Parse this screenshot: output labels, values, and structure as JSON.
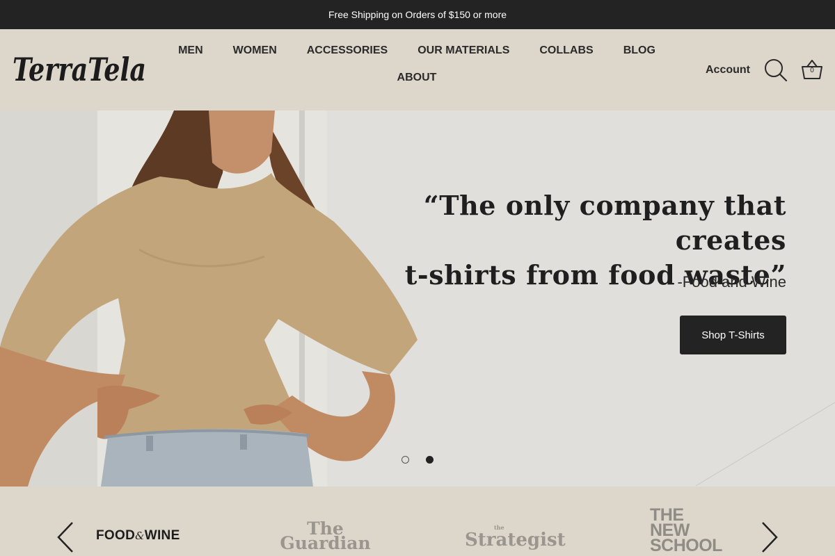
{
  "announcement": "Free Shipping on Orders of $150 or more",
  "brand": {
    "name": "TerraTela"
  },
  "nav": {
    "items": [
      "MEN",
      "WOMEN",
      "ACCESSORIES",
      "OUR MATERIALS",
      "COLLABS",
      "BLOG",
      "ABOUT"
    ]
  },
  "header_actions": {
    "account_label": "Account",
    "search_icon": "search-icon",
    "cart_icon": "basket-icon",
    "cart_count": "0"
  },
  "hero": {
    "quote_line1": "“The only company that creates",
    "quote_line2": "t-shirts from food waste”",
    "attribution": "-Food and Wine",
    "cta_label": "Shop T-Shirts",
    "slides_total": 2,
    "active_slide": 2
  },
  "press": {
    "logos": [
      {
        "name": "FOOD & WINE",
        "parts": [
          "FOOD",
          "&",
          "WINE"
        ]
      },
      {
        "name": "The Guardian",
        "parts": [
          "The",
          "Guardian"
        ]
      },
      {
        "name": "The Strategist",
        "parts": [
          "the",
          "Strategist"
        ]
      },
      {
        "name": "THE NEW SCHOOL",
        "parts": [
          "THE",
          "NEW",
          "SCHOOL"
        ]
      }
    ],
    "prev_icon": "chevron-left-icon",
    "next_icon": "chevron-right-icon"
  },
  "colors": {
    "announcement_bg": "#232323",
    "page_bg": "#ddd6cb",
    "button_bg": "#232323",
    "text": "#222222"
  }
}
